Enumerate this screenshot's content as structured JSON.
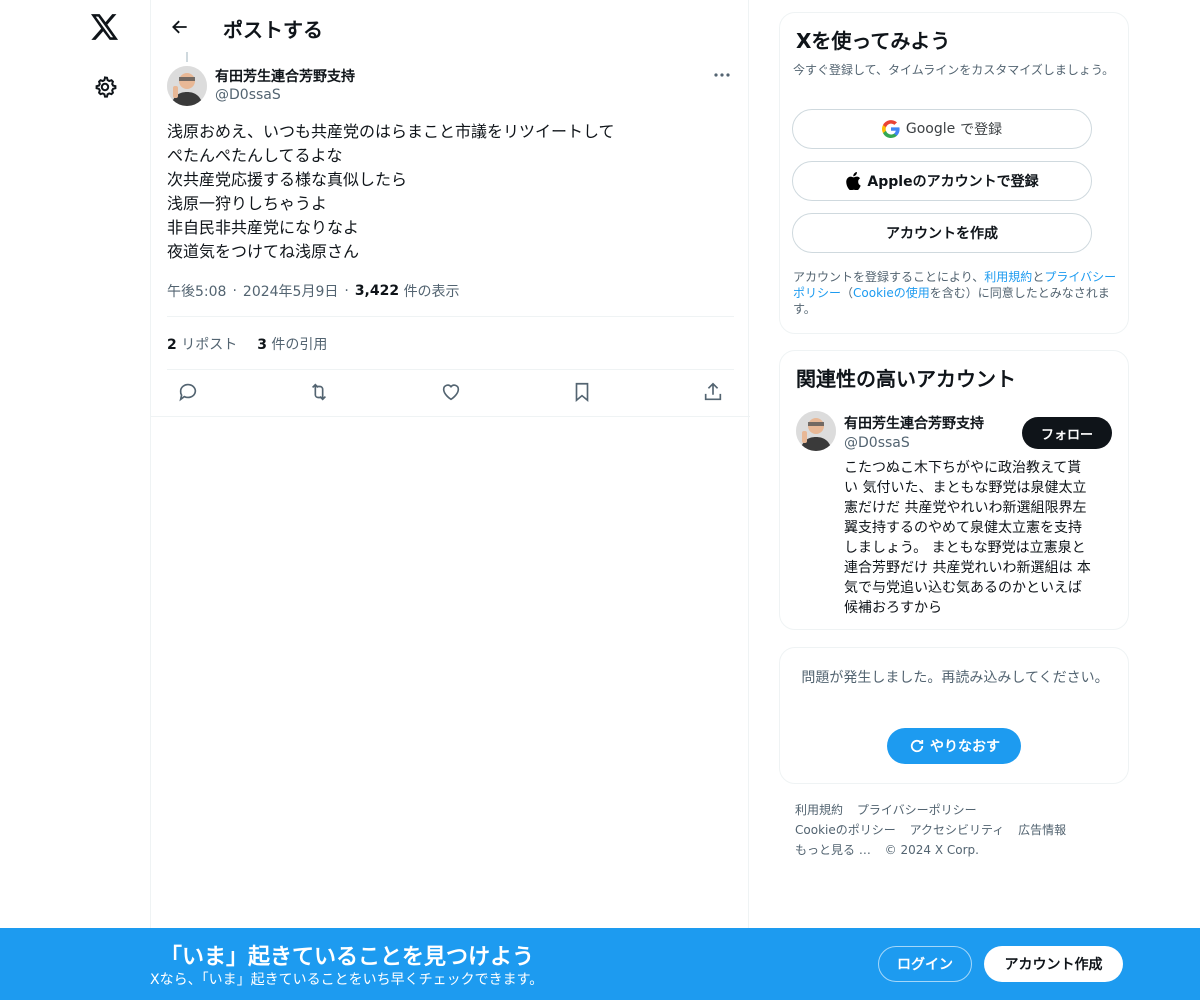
{
  "nav": {
    "logo_icon": "x-logo-icon",
    "settings_icon": "gear-icon"
  },
  "header": {
    "title": "ポストする"
  },
  "post": {
    "author_name": "有田芳生連合芳野支持",
    "author_handle": "@D0ssaS",
    "lines": [
      "浅原おめえ、いつも共産党のはらまこと市議をリツイートして",
      "ぺたんぺたんしてるよな",
      "次共産党応援する様な真似したら",
      "浅原一狩りしちゃうよ",
      "非自民非共産党になりなよ",
      "夜道気をつけてね浅原さん"
    ],
    "time": "午後5:08",
    "date": "2024年5月9日",
    "views_count": "3,422",
    "views_label": "件の表示",
    "reposts_count": "2",
    "reposts_label": "リポスト",
    "quotes_count": "3",
    "quotes_label": "件の引用"
  },
  "signup": {
    "title": "Xを使ってみよう",
    "subtitle": "今すぐ登録して、タイムラインをカスタマイズしましょう。",
    "google_brand": "Google",
    "google_suffix": "で登録",
    "apple_label": "Appleのアカウントで登録",
    "create_label": "アカウントを作成",
    "terms_pre": "アカウントを登録することにより、",
    "terms_link1": "利用規約",
    "terms_and": "と",
    "terms_link2": "プライバシーポリシー",
    "terms_paren_open": "（",
    "terms_link3": "Cookieの使用",
    "terms_post": "を含む）に同意したとみなされます。"
  },
  "related": {
    "title": "関連性の高いアカウント",
    "name": "有田芳生連合芳野支持",
    "handle": "@D0ssaS",
    "follow_label": "フォロー",
    "bio_lines": [
      "こたつぬこ木下ちがやに政治教えて貰",
      "い 気付いた、まともな野党は泉健太立",
      "憲だけだ 共産党やれいわ新選組限界左",
      "翼支持するのやめて泉健太立憲を支持",
      "しましょう。 まともな野党は立憲泉と",
      "連合芳野だけ 共産党れいわ新選組は 本",
      "気で与党追い込む気あるのかといえば",
      "候補おろすから"
    ]
  },
  "error": {
    "message": "問題が発生しました。再読み込みしてください。",
    "retry_label": "やりなおす"
  },
  "footer": {
    "links": [
      "利用規約",
      "プライバシーポリシー",
      "Cookieのポリシー",
      "アクセシビリティ",
      "広告情報",
      "もっと見る …"
    ],
    "copyright": "© 2024 X Corp."
  },
  "banner": {
    "title": "「いま」起きていることを見つけよう",
    "subtitle": "Xなら、「いま」起きていることをいち早くチェックできます。",
    "login_label": "ログイン",
    "create_label": "アカウント作成"
  },
  "colors": {
    "accent": "#1d9bf0",
    "text": "#0f1419",
    "muted": "#536471",
    "border": "#eff3f4"
  }
}
